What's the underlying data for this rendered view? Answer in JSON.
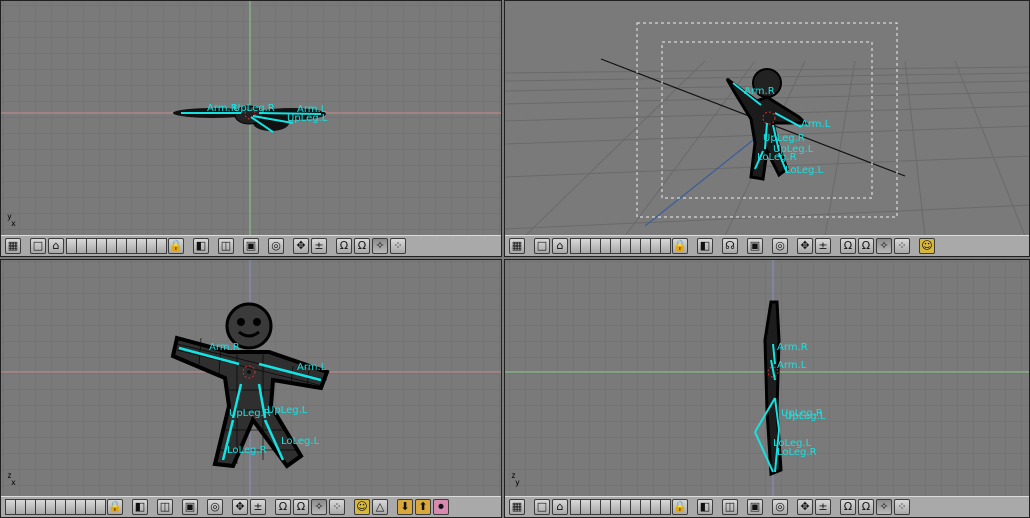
{
  "viewports": {
    "top": {
      "axis_up": "y",
      "axis_right": "x",
      "bones": [
        "Arm.R",
        "UpLeg.R",
        "Arm.L",
        "UpLeg.L"
      ]
    },
    "camera": {
      "bones": [
        "Arm.R",
        "Arm.L",
        "UpLeg.R",
        "UpLeg.L",
        "LoLeg.R",
        "LoLeg.L"
      ]
    },
    "front": {
      "axis_up": "z",
      "axis_right": "x",
      "bones": [
        "Arm.R",
        "Arm.L",
        "UpLeg.R",
        "UpLeg.L",
        "LoLeg.R",
        "LoLeg.L"
      ]
    },
    "side": {
      "axis_up": "z",
      "axis_right": "y",
      "bones": [
        "Arm.R",
        "Arm.L",
        "UpLeg.R",
        "UpLeg.L",
        "LoLeg.L",
        "LoLeg.R"
      ]
    }
  },
  "header": {
    "toggle_icon": "±",
    "buttons": [
      "view-grid-icon",
      "layer-icon",
      "home-icon",
      "lock-icon",
      "pivot-icon",
      "draw-type-icon",
      "move-icon",
      "rotate-icon",
      "scale-icon",
      "snap-icon"
    ]
  },
  "colors": {
    "viewport_bg": "#7a7a7a",
    "grid": "#6b6b6b",
    "header_bg": "#a9a9a9",
    "bone": "#15e3e3",
    "x_axis": "#c98c8c",
    "y_axis": "#8cc98c",
    "z_axis": "#8c8ccf"
  }
}
